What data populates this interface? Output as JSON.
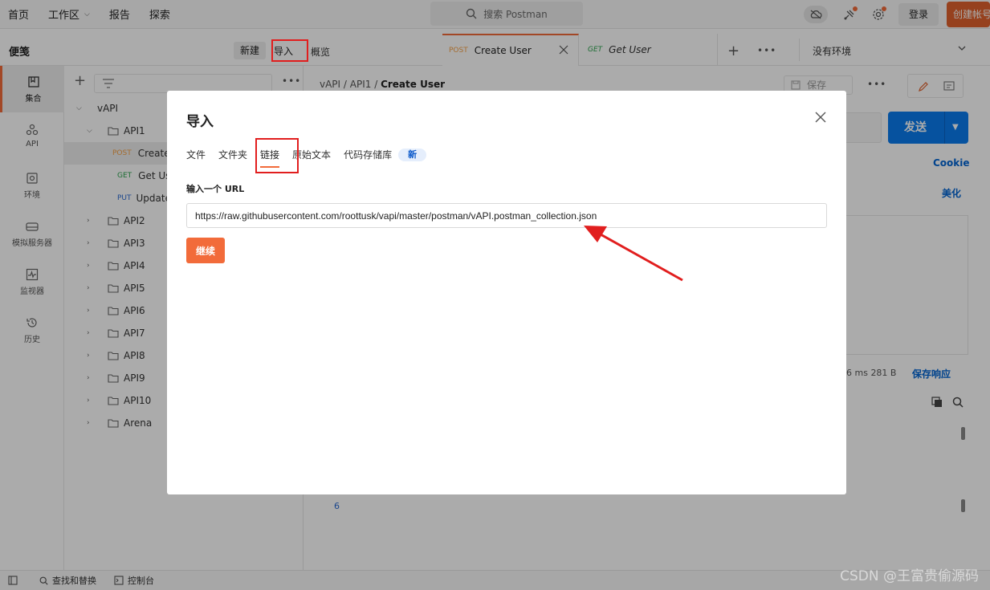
{
  "topbar": {
    "nav": [
      "首页",
      "工作区",
      "报告",
      "探索"
    ],
    "search_placeholder": "搜索 Postman",
    "login_label": "登录",
    "create_label": "创建帐号"
  },
  "header": {
    "sidebar_title": "便笺",
    "new_label": "新建",
    "import_label": "导入",
    "overview_label": "概览",
    "tabs": [
      {
        "method": "POST",
        "name": "Create User"
      },
      {
        "method": "GET",
        "name": "Get User"
      }
    ],
    "more_label": "•••",
    "env_label": "没有环境"
  },
  "iconbar": {
    "items": [
      "集合",
      "API",
      "环境",
      "模拟服务器",
      "监视器",
      "历史"
    ]
  },
  "sidebar": {
    "more_label": "•••",
    "collection": "vAPI",
    "folder_open": "API1",
    "requests": [
      {
        "method": "POST",
        "name": "Create"
      },
      {
        "method": "GET",
        "name": "Get Use"
      },
      {
        "method": "PUT",
        "name": "Update"
      }
    ],
    "folders": [
      "API2",
      "API3",
      "API4",
      "API5",
      "API6",
      "API7",
      "API8",
      "API9",
      "API10",
      "Arena"
    ]
  },
  "rightpane": {
    "breadcrumb": [
      "vAPI",
      "API1",
      "Create User"
    ],
    "save_label": "保存",
    "send_label": "发送",
    "cookie_label": "Cookie",
    "beautify_label": "美化",
    "resp_meta": "6 ms   281 B",
    "save_resp_label": "保存响应",
    "line_no": "6"
  },
  "modal": {
    "title": "导入",
    "tabs": [
      "文件",
      "文件夹",
      "链接",
      "原始文本",
      "代码存储库"
    ],
    "active_tab": "链接",
    "new_badge": "新",
    "url_label": "输入一个 URL",
    "url_value": "https://raw.githubusercontent.com/roottusk/vapi/master/postman/vAPI.postman_collection.json",
    "continue_label": "继续"
  },
  "statusbar": {
    "find_replace": "查找和替换",
    "console": "控制台"
  },
  "watermark": "CSDN @王富贵偷源码",
  "colors": {
    "accent": "#f26b3a",
    "send_blue": "#097bed",
    "highlight_red": "#e11e1e"
  }
}
